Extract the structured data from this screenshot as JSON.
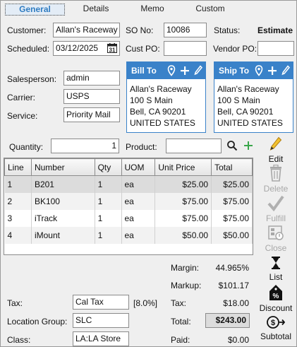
{
  "tabs": [
    {
      "label": "General",
      "active": true
    },
    {
      "label": "Details",
      "active": false
    },
    {
      "label": "Memo",
      "active": false
    },
    {
      "label": "Custom",
      "active": false
    }
  ],
  "header": {
    "customer_label": "Customer:",
    "customer_value": "Allan's Raceway",
    "so_label": "SO No:",
    "so_value": "10086",
    "status_label": "Status:",
    "status_value": "Estimate",
    "scheduled_label": "Scheduled:",
    "scheduled_value": "03/12/2025",
    "custpo_label": "Cust PO:",
    "custpo_value": "",
    "vendorpo_label": "Vendor PO:",
    "vendorpo_value": ""
  },
  "shipping": {
    "salesperson_label": "Salesperson:",
    "salesperson_value": "admin",
    "carrier_label": "Carrier:",
    "carrier_value": "USPS",
    "service_label": "Service:",
    "service_value": "Priority Mail"
  },
  "bill_to": {
    "title": "Bill To",
    "lines": [
      "Allan's Raceway",
      "100 S Main",
      "Bell, CA  90201",
      "UNITED STATES"
    ]
  },
  "ship_to": {
    "title": "Ship To",
    "lines": [
      "Allan's Raceway",
      "100 S Main",
      "Bell, CA  90201",
      "UNITED STATES"
    ]
  },
  "entry": {
    "quantity_label": "Quantity:",
    "quantity_value": "1",
    "product_label": "Product:",
    "product_value": ""
  },
  "table": {
    "headers": [
      "Line",
      "Number",
      "Qty",
      "UOM",
      "Unit Price",
      "Total"
    ],
    "rows": [
      [
        "1",
        "B201",
        "1",
        "ea",
        "$25.00",
        "$25.00"
      ],
      [
        "2",
        "BK100",
        "1",
        "ea",
        "$75.00",
        "$75.00"
      ],
      [
        "3",
        "iTrack",
        "1",
        "ea",
        "$75.00",
        "$75.00"
      ],
      [
        "4",
        "iMount",
        "1",
        "ea",
        "$50.00",
        "$50.00"
      ]
    ]
  },
  "side_buttons": {
    "edit": "Edit",
    "delete": "Delete",
    "fulfill": "Fulfill",
    "close": "Close",
    "list": "List",
    "discount": "Discount",
    "subtotal": "Subtotal"
  },
  "totals": {
    "margin_label": "Margin:",
    "margin_value": "44.965%",
    "markup_label": "Markup:",
    "markup_value": "$101.17",
    "tax_label": "Tax:",
    "tax_value": "$18.00",
    "total_label": "Total:",
    "total_value": "$243.00",
    "paid_label": "Paid:",
    "paid_value": "$0.00"
  },
  "footer": {
    "tax_label": "Tax:",
    "tax_value": "Cal Tax",
    "tax_rate": "[8.0%]",
    "location_label": "Location Group:",
    "location_value": "SLC",
    "class_label": "Class:",
    "class_value": "LA:LA Store"
  },
  "colors": {
    "accent": "#3a82c9",
    "tab_active_text": "#2f7cc1",
    "disabled": "#a8a8a8"
  }
}
